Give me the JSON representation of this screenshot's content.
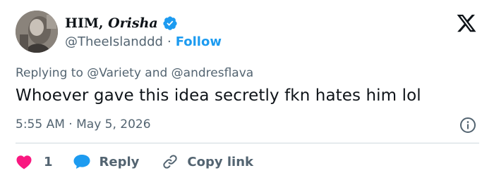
{
  "author": {
    "display_name_main": "HIM,",
    "display_name_italic": "Orisha",
    "handle": "@TheeIslanddd",
    "separator": "·",
    "follow_label": "Follow",
    "avatar_icon": "profile-photo",
    "verified_icon": "verified-badge-icon"
  },
  "reply_context": {
    "prefix": "Replying to",
    "mention_1": "@Variety",
    "joiner": "and",
    "mention_2": "@andresflava"
  },
  "tweet": {
    "text": "Whoever gave this idea secretly fkn hates him lol",
    "time": "5:55 AM",
    "separator": "·",
    "date": "May 5, 2026"
  },
  "actions": {
    "like_count": "1",
    "reply_label": "Reply",
    "copy_label": "Copy link"
  },
  "colors": {
    "accent": "#1d9bf0",
    "like": "#f91880",
    "text_primary": "#0f1419",
    "text_secondary": "#536471",
    "divider": "#cfd9de"
  }
}
